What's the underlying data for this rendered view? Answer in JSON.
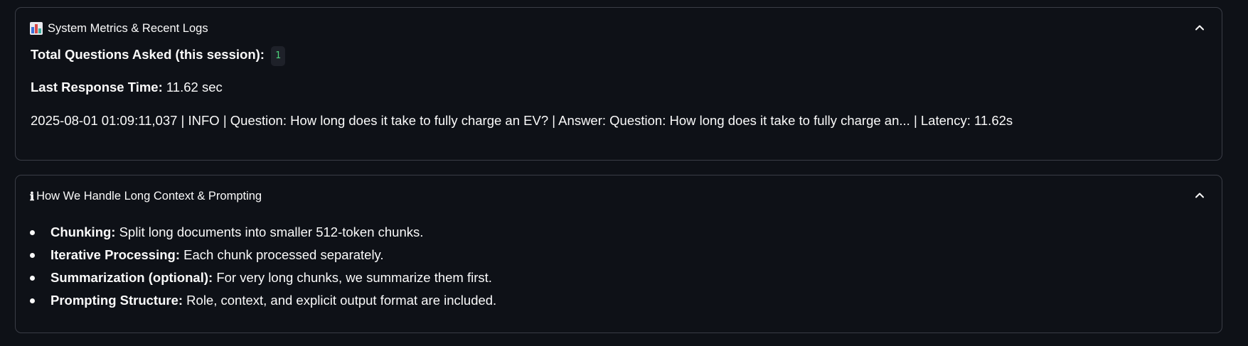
{
  "metrics_expander": {
    "icon": "bar-chart-icon",
    "title": "System Metrics & Recent Logs",
    "total_questions_label": "Total Questions Asked (this session):",
    "total_questions_value": "1",
    "last_response_label": "Last Response Time:",
    "last_response_value": "11.62 sec",
    "log_line": "2025-08-01 01:09:11,037 | INFO | Question: How long does it take to fully charge an EV? | Answer: Question: How long does it take to fully charge an... | Latency: 11.62s"
  },
  "context_expander": {
    "icon": "info-icon",
    "info_glyph": "ℹ",
    "title": "How We Handle Long Context & Prompting",
    "items": [
      {
        "label": "Chunking:",
        "text": "Split long documents into smaller 512-token chunks."
      },
      {
        "label": "Iterative Processing:",
        "text": "Each chunk processed separately."
      },
      {
        "label": "Summarization (optional):",
        "text": "For very long chunks, we summarize them first."
      },
      {
        "label": "Prompting Structure:",
        "text": "Role, context, and explicit output format are included."
      }
    ]
  },
  "colors": {
    "background": "#0e1117",
    "border": "#3a3d46",
    "text": "#fafafa",
    "code_text": "#4dd27a",
    "code_bg": "#1e2129"
  }
}
